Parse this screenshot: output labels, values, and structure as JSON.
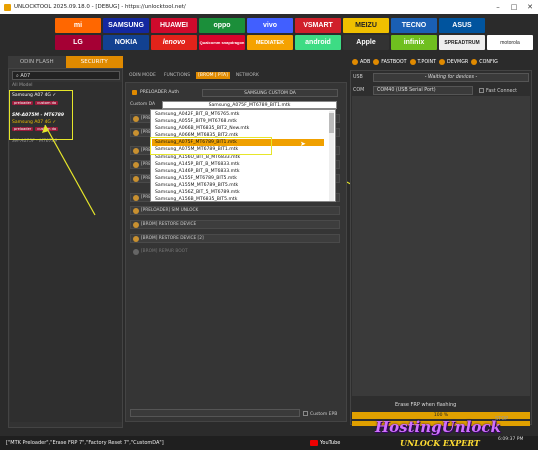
{
  "window": {
    "title": "UNLOCKTOOL 2025.09.18.0 - [DEBUG] - https://unlocktool.net/"
  },
  "brands": [
    "mi",
    "SAMSUNG",
    "HUAWEI",
    "oppo",
    "vivo",
    "VSMART",
    "MEIZU",
    "TECNO",
    "ASUS",
    "LG",
    "NOKIA",
    "lenovo",
    "Qualcomm snapdragon",
    "MEDIATEK",
    "android",
    "Apple",
    "infinix",
    "SPREADTRUM",
    "motorola"
  ],
  "left_tabs": [
    "ODIN FLASH",
    "SECURITY"
  ],
  "search": {
    "value": "A07"
  },
  "models": {
    "all": "All Model",
    "item1": "Samsung A07 4G ✓",
    "item1_tags": [
      "preloader",
      "custom da"
    ],
    "item2": "SM-A075M - MT6789",
    "item2_sub": "Samsung A07 4G ✓",
    "item2_tags": [
      "preloader",
      "custom da"
    ],
    "item3": "SM-A075F - MT6789"
  },
  "center_tabs": [
    "ODIN MODE",
    "FUNCTIONS",
    "[BROM | PTA]",
    "NETWORK"
  ],
  "preloader_auth": "PRELOADER Auth",
  "custom_da_select": "SAMSUNG CUSTOM DA",
  "custom_da_label": "Custom DA",
  "da_selected": "Samsung_A075F_MT6789_BIT1.mtk",
  "da_list": [
    "Samsung_A042F_BIT_B_MT6765.mtk",
    "Samsung_A055F_BIT9_MT6768.mtk",
    "Samsung_A066B_MT6835_BIT2_New.mtk",
    "Samsung_A066M_MT6835_BIT2.mtk",
    "Samsung_A075F_MT6789_BIT1.mtk",
    "Samsung_A075M_MT6789_BIT1.mtk",
    "Samsung_A156U_BIT_B_MT6833.mtk",
    "Samsung_A145P_BIT_B_MT6833.mtk",
    "Samsung_A146P_BIT_B_MT6833.mtk",
    "Samsung_A155F_MT6789_BIT5.mtk",
    "Samsung_A155M_MT6789_BIT5.mtk",
    "Samsung_A156Z_BIT_5_MT6789.mtk",
    "Samsung_A156B_MT6835_BIT5.mtk"
  ],
  "rows": {
    "r1": "[PRELOADER]",
    "r2": "[PREL",
    "r3": "[PREL",
    "r4": "[PREL",
    "r5": "[PREL",
    "r6": "[PRELOADER]",
    "r7": "[PRELOADER] SIM UNLOCK",
    "r8": "[BROM] RESTORE DEVICE",
    "r9": "[BROM] RESTORE DEVICE [2]",
    "r10": "[BROM] REPAIR BOOT"
  },
  "custom_epb": "Custom EPB",
  "right_buttons": [
    "ADB",
    "FASTBOOT",
    "T.POINT",
    "DEVMGR",
    "CONFIG"
  ],
  "usb": {
    "label": "USB",
    "status": "- Waiting for devices -"
  },
  "com": {
    "label": "COM",
    "value": "COM40 (USB Serial Port)",
    "fast_connect": "Fast Connect"
  },
  "erase_frp": "Erase FRP when flashing",
  "progress": {
    "value": 100,
    "text": "100 %"
  },
  "stop": "STOP",
  "status_bar": "[\"MTK Preloader\",\"Erase FRP 7\",\"Factory Reset 7\",\"CustomDA\"]",
  "youtube": "YouTube",
  "watermark": "HostingUnlock",
  "watermark2": "UNLOCK EXPERT",
  "clock": "6:09:37 PM",
  "colors": {
    "accent": "#e08a00",
    "highlight": "#e6e62a",
    "selected": "#f0a000"
  }
}
